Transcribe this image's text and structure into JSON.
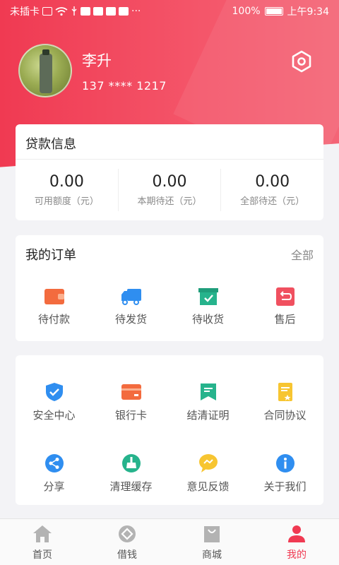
{
  "status_bar": {
    "carrier": "未插卡",
    "battery": "100%",
    "time": "上午9:34",
    "more": "···"
  },
  "profile": {
    "name": "李升",
    "phone": "137 **** 1217"
  },
  "loan": {
    "title": "贷款信息",
    "stats": [
      {
        "value": "0.00",
        "label": "可用额度（元）"
      },
      {
        "value": "0.00",
        "label": "本期待还（元）"
      },
      {
        "value": "0.00",
        "label": "全部待还（元）"
      }
    ]
  },
  "orders": {
    "title": "我的订单",
    "see_all": "全部",
    "items": [
      {
        "label": "待付款",
        "icon": "wallet-icon",
        "color": "#f36b3e"
      },
      {
        "label": "待发货",
        "icon": "truck-icon",
        "color": "#2f8ef0"
      },
      {
        "label": "待收货",
        "icon": "box-check-icon",
        "color": "#26b38c"
      },
      {
        "label": "售后",
        "icon": "return-icon",
        "color": "#f0505f"
      }
    ]
  },
  "services": {
    "items": [
      {
        "label": "安全中心",
        "icon": "shield-icon",
        "color": "#2f8ef0"
      },
      {
        "label": "银行卡",
        "icon": "bank-card-icon",
        "color": "#f36b3e"
      },
      {
        "label": "结清证明",
        "icon": "certificate-icon",
        "color": "#26b38c"
      },
      {
        "label": "合同协议",
        "icon": "contract-icon",
        "color": "#f7c531"
      },
      {
        "label": "分享",
        "icon": "share-icon",
        "color": "#2f8ef0"
      },
      {
        "label": "清理缓存",
        "icon": "broom-icon",
        "color": "#26b38c"
      },
      {
        "label": "意见反馈",
        "icon": "feedback-icon",
        "color": "#f7c531"
      },
      {
        "label": "关于我们",
        "icon": "info-icon",
        "color": "#2f8ef0"
      }
    ]
  },
  "tabbar": {
    "tabs": [
      {
        "label": "首页",
        "icon": "home-icon",
        "active": false
      },
      {
        "label": "借钱",
        "icon": "borrow-icon",
        "active": false
      },
      {
        "label": "商城",
        "icon": "shop-bag-icon",
        "active": false
      },
      {
        "label": "我的",
        "icon": "user-icon",
        "active": true
      }
    ]
  },
  "colors": {
    "brand": "#f03a52",
    "page_bg": "#f3f3f6"
  }
}
